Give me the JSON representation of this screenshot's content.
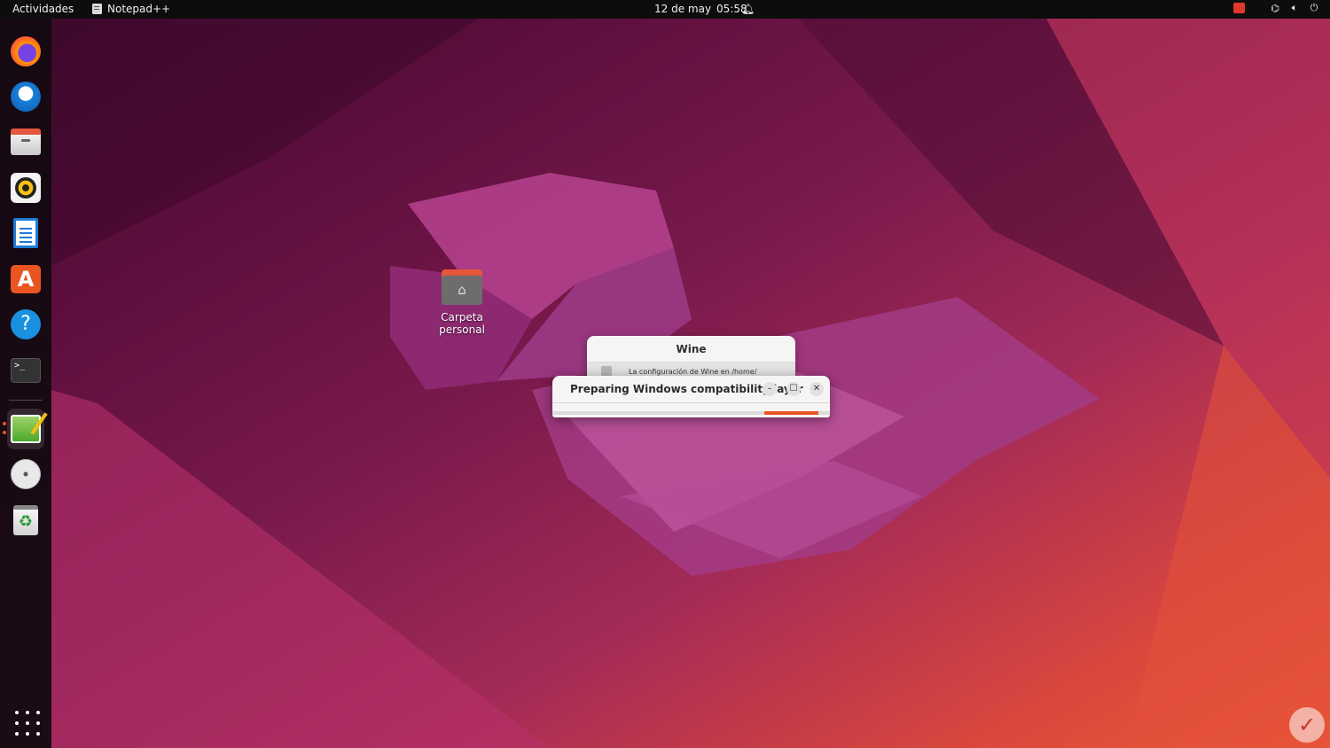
{
  "topbar": {
    "activities_label": "Actividades",
    "app_name": "Notepad++",
    "date": "12 de may",
    "time": "05:58"
  },
  "dock": {
    "items": [
      {
        "name": "Firefox",
        "icon": "firefox-icon"
      },
      {
        "name": "Thunderbird",
        "icon": "thunderbird-icon"
      },
      {
        "name": "Files",
        "icon": "files-icon"
      },
      {
        "name": "Rhythmbox",
        "icon": "rhythmbox-icon"
      },
      {
        "name": "LibreOffice Writer",
        "icon": "writer-icon"
      },
      {
        "name": "Ubuntu Software",
        "icon": "software-store-icon"
      },
      {
        "name": "Help",
        "icon": "help-icon"
      },
      {
        "name": "Terminal",
        "icon": "terminal-icon"
      },
      {
        "name": "Notepad++",
        "icon": "notepad-plus-plus-icon",
        "active": true
      },
      {
        "name": "CD/DVD",
        "icon": "optical-disc-icon"
      },
      {
        "name": "Trash",
        "icon": "trash-icon"
      }
    ],
    "apps_grid_icon": "show-applications-icon",
    "store_glyph": "A",
    "help_glyph": "?",
    "terminal_glyph": ">_",
    "trash_glyph": "♻"
  },
  "desktop": {
    "home_folder_label": "Carpeta personal"
  },
  "wine_dialog": {
    "title": "Wine",
    "message": "La configuración de Wine en /home/"
  },
  "progress_dialog": {
    "title": "Preparing Windows compatibility layer",
    "minimize_glyph": "–",
    "maximize_glyph": "☐",
    "close_glyph": "✕",
    "progress_range": [
      0.765,
      0.96
    ]
  },
  "colors": {
    "accent": "#e95420",
    "topbar": "#0d0d0d"
  }
}
